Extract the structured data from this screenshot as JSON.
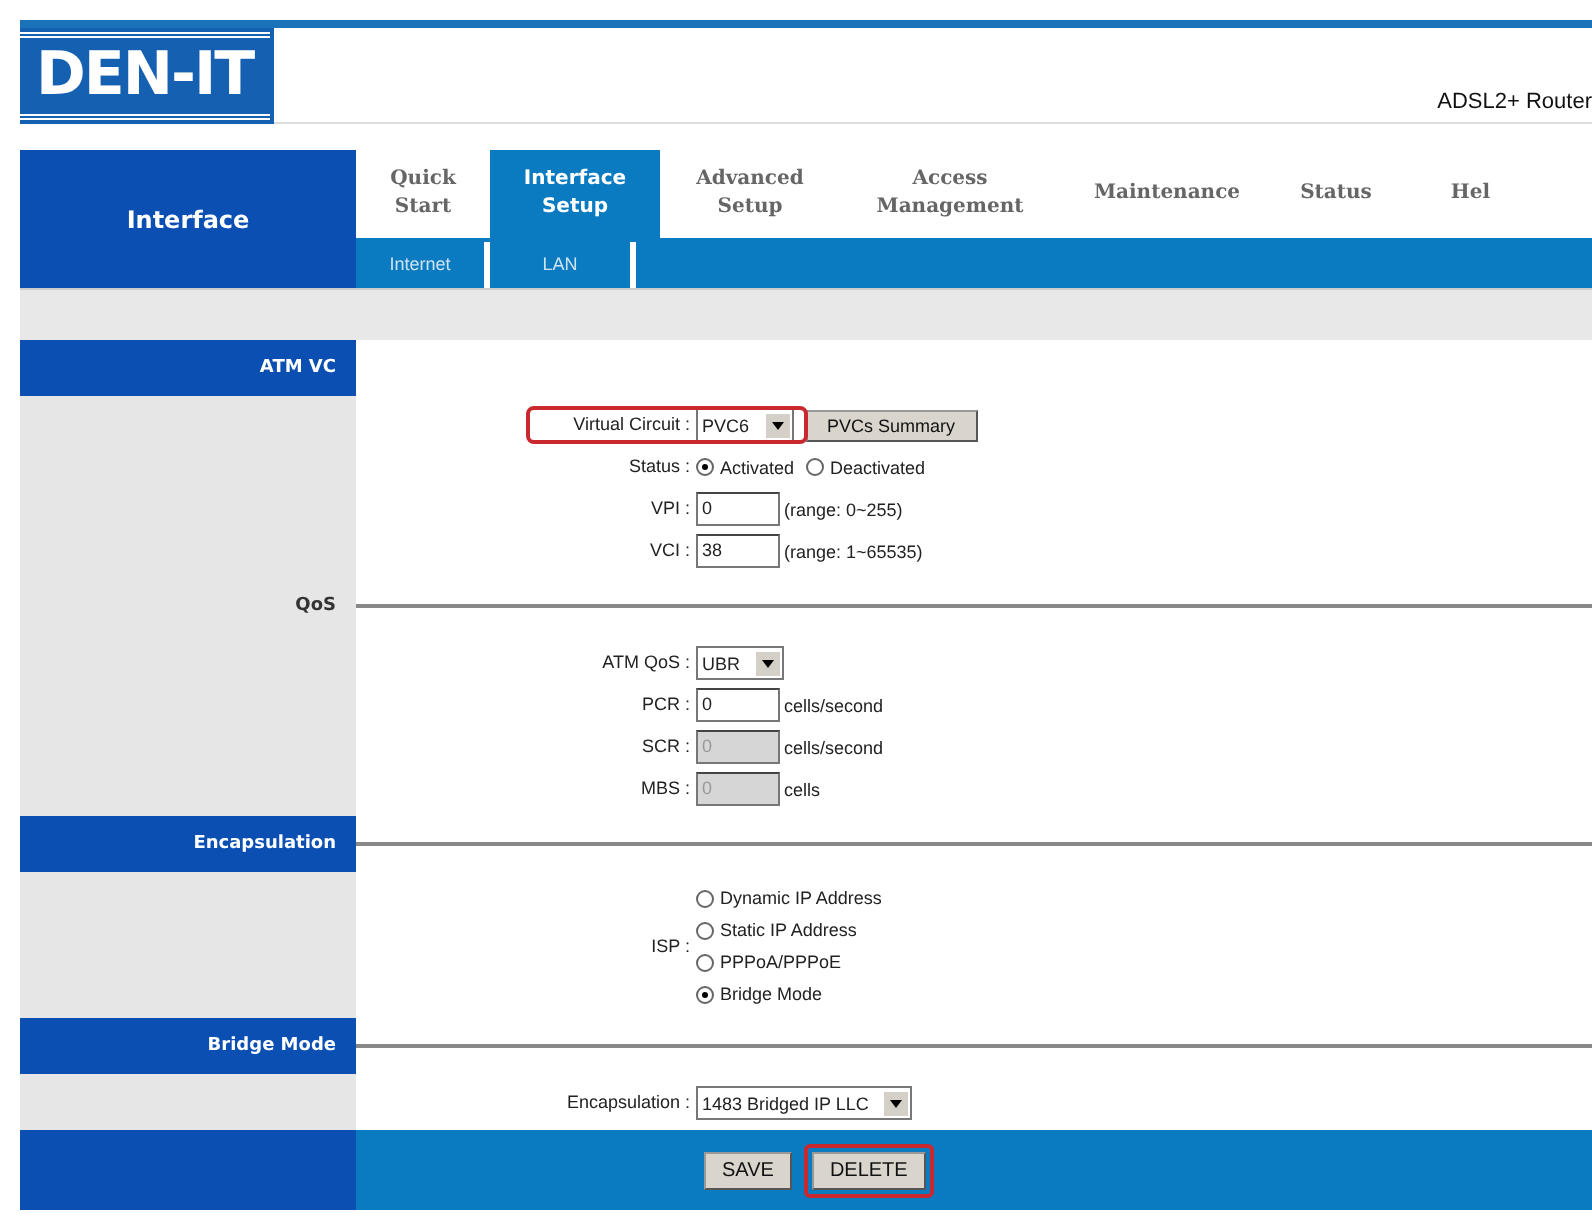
{
  "logo": "DEN-IT",
  "product": "ADSL2+ Router",
  "side_title": "Interface",
  "tabs": [
    {
      "label": "Quick\nStart",
      "selected": false
    },
    {
      "label": "Interface\nSetup",
      "selected": true
    },
    {
      "label": "Advanced\nSetup",
      "selected": false
    },
    {
      "label": "Access\nManagement",
      "selected": false
    },
    {
      "label": "Maintenance",
      "selected": false
    },
    {
      "label": "Status",
      "selected": false
    },
    {
      "label": "Hel",
      "selected": false
    }
  ],
  "subtabs": [
    "Internet",
    "LAN"
  ],
  "sections": [
    {
      "title": "ATM VC",
      "banner": true,
      "rule": false,
      "rows": [
        {
          "kind": "select",
          "label": "Virtual Circuit :",
          "value": "PVC6",
          "highlighted": true,
          "button": "PVCs Summary"
        },
        {
          "kind": "radio",
          "label": "Status :",
          "options": [
            {
              "label": "Activated",
              "selected": true
            },
            {
              "label": "Deactivated",
              "selected": false
            }
          ]
        },
        {
          "kind": "input",
          "label": "VPI :",
          "value": "0",
          "disabled": false,
          "note": "(range: 0~255)"
        },
        {
          "kind": "input",
          "label": "VCI :",
          "value": "38",
          "disabled": false,
          "note": "(range: 1~65535)"
        }
      ]
    },
    {
      "title": "QoS",
      "banner": false,
      "rule": true,
      "rows": [
        {
          "kind": "select",
          "label": "ATM QoS :",
          "value": "UBR",
          "highlighted": false
        },
        {
          "kind": "input",
          "label": "PCR :",
          "value": "0",
          "disabled": false,
          "note": "cells/second"
        },
        {
          "kind": "input",
          "label": "SCR :",
          "value": "0",
          "disabled": true,
          "note": "cells/second"
        },
        {
          "kind": "input",
          "label": "MBS :",
          "value": "0",
          "disabled": true,
          "note": "cells"
        }
      ]
    },
    {
      "title": "Encapsulation",
      "banner": true,
      "rule": true,
      "rows": [
        {
          "kind": "radio-list",
          "label": "ISP :",
          "options": [
            {
              "label": "Dynamic IP Address",
              "selected": false
            },
            {
              "label": "Static IP Address",
              "selected": false
            },
            {
              "label": "PPPoA/PPPoE",
              "selected": false
            },
            {
              "label": "Bridge Mode",
              "selected": true
            }
          ]
        }
      ]
    },
    {
      "title": "Bridge Mode",
      "banner": true,
      "rule": true,
      "rows": [
        {
          "kind": "select",
          "label": "Encapsulation :",
          "value": "1483 Bridged IP LLC",
          "highlighted": false
        }
      ]
    }
  ],
  "buttons": [
    {
      "label": "SAVE",
      "highlighted": false
    },
    {
      "label": "DELETE",
      "highlighted": true
    }
  ]
}
